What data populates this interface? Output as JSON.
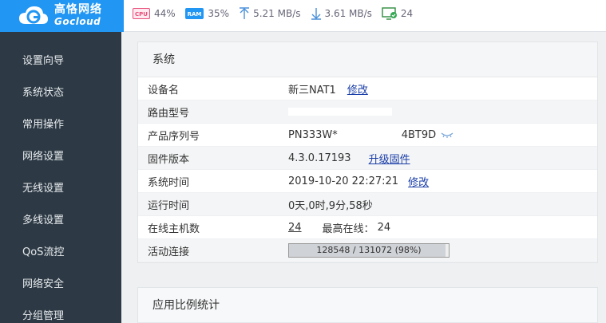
{
  "brand": {
    "name_cn": "高恪网络",
    "name_en": "Gocloud",
    "color": "#2196f3"
  },
  "status_bar": {
    "cpu_chip": "CPU",
    "cpu": "44%",
    "ram_chip": "RAM",
    "ram": "35%",
    "upload": "5.21 MB/s",
    "download": "3.61 MB/s",
    "online": "24"
  },
  "sidebar": {
    "items": [
      {
        "label": "设置向导"
      },
      {
        "label": "系统状态"
      },
      {
        "label": "常用操作"
      },
      {
        "label": "网络设置"
      },
      {
        "label": "无线设置"
      },
      {
        "label": "多线设置"
      },
      {
        "label": "QoS流控"
      },
      {
        "label": "网络安全"
      },
      {
        "label": "分组管理"
      }
    ]
  },
  "system_panel": {
    "title": "系统",
    "rows": {
      "device_name": {
        "key": "设备名",
        "value": "新三NAT1",
        "action": "修改"
      },
      "model": {
        "key": "路由型号",
        "value": ""
      },
      "serial": {
        "key": "产品序列号",
        "value_prefix": "PN333W*",
        "value_suffix": "4BT9D"
      },
      "firmware": {
        "key": "固件版本",
        "value": "4.3.0.17193",
        "action": "升级固件"
      },
      "system_time": {
        "key": "系统时间",
        "value": "2019-10-20 22:27:21",
        "action": "修改"
      },
      "uptime": {
        "key": "运行时间",
        "value": "0天,0时,9分,58秒"
      },
      "hosts": {
        "key": "在线主机数",
        "value": "24",
        "max_label": "最高在线：",
        "max_value": "24"
      },
      "connections": {
        "key": "活动连接",
        "value": "128548 / 131072 (98%)",
        "fraction": 0.98
      }
    }
  },
  "app_panel": {
    "title": "应用比例统计"
  }
}
